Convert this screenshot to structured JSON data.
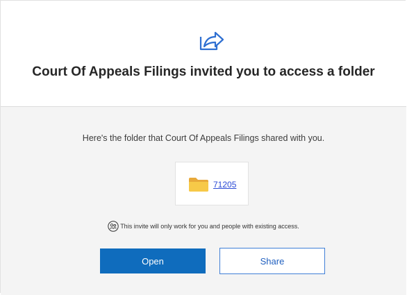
{
  "header": {
    "icon": "share-arrow-icon",
    "title": "Court Of Appeals Filings invited you to access a folder"
  },
  "main": {
    "description": "Here's the folder that Court Of Appeals Filings shared with you.",
    "folder": {
      "icon": "folder-icon",
      "name": "71205"
    },
    "note": {
      "icon": "people-icon",
      "text": "This invite will only work for you and people with existing access."
    },
    "buttons": {
      "open_label": "Open",
      "share_label": "Share"
    }
  },
  "colors": {
    "accent": "#0f6cbd",
    "folder": "#f4c342",
    "link": "#2b4bd6",
    "body_bg": "#f4f4f4"
  }
}
